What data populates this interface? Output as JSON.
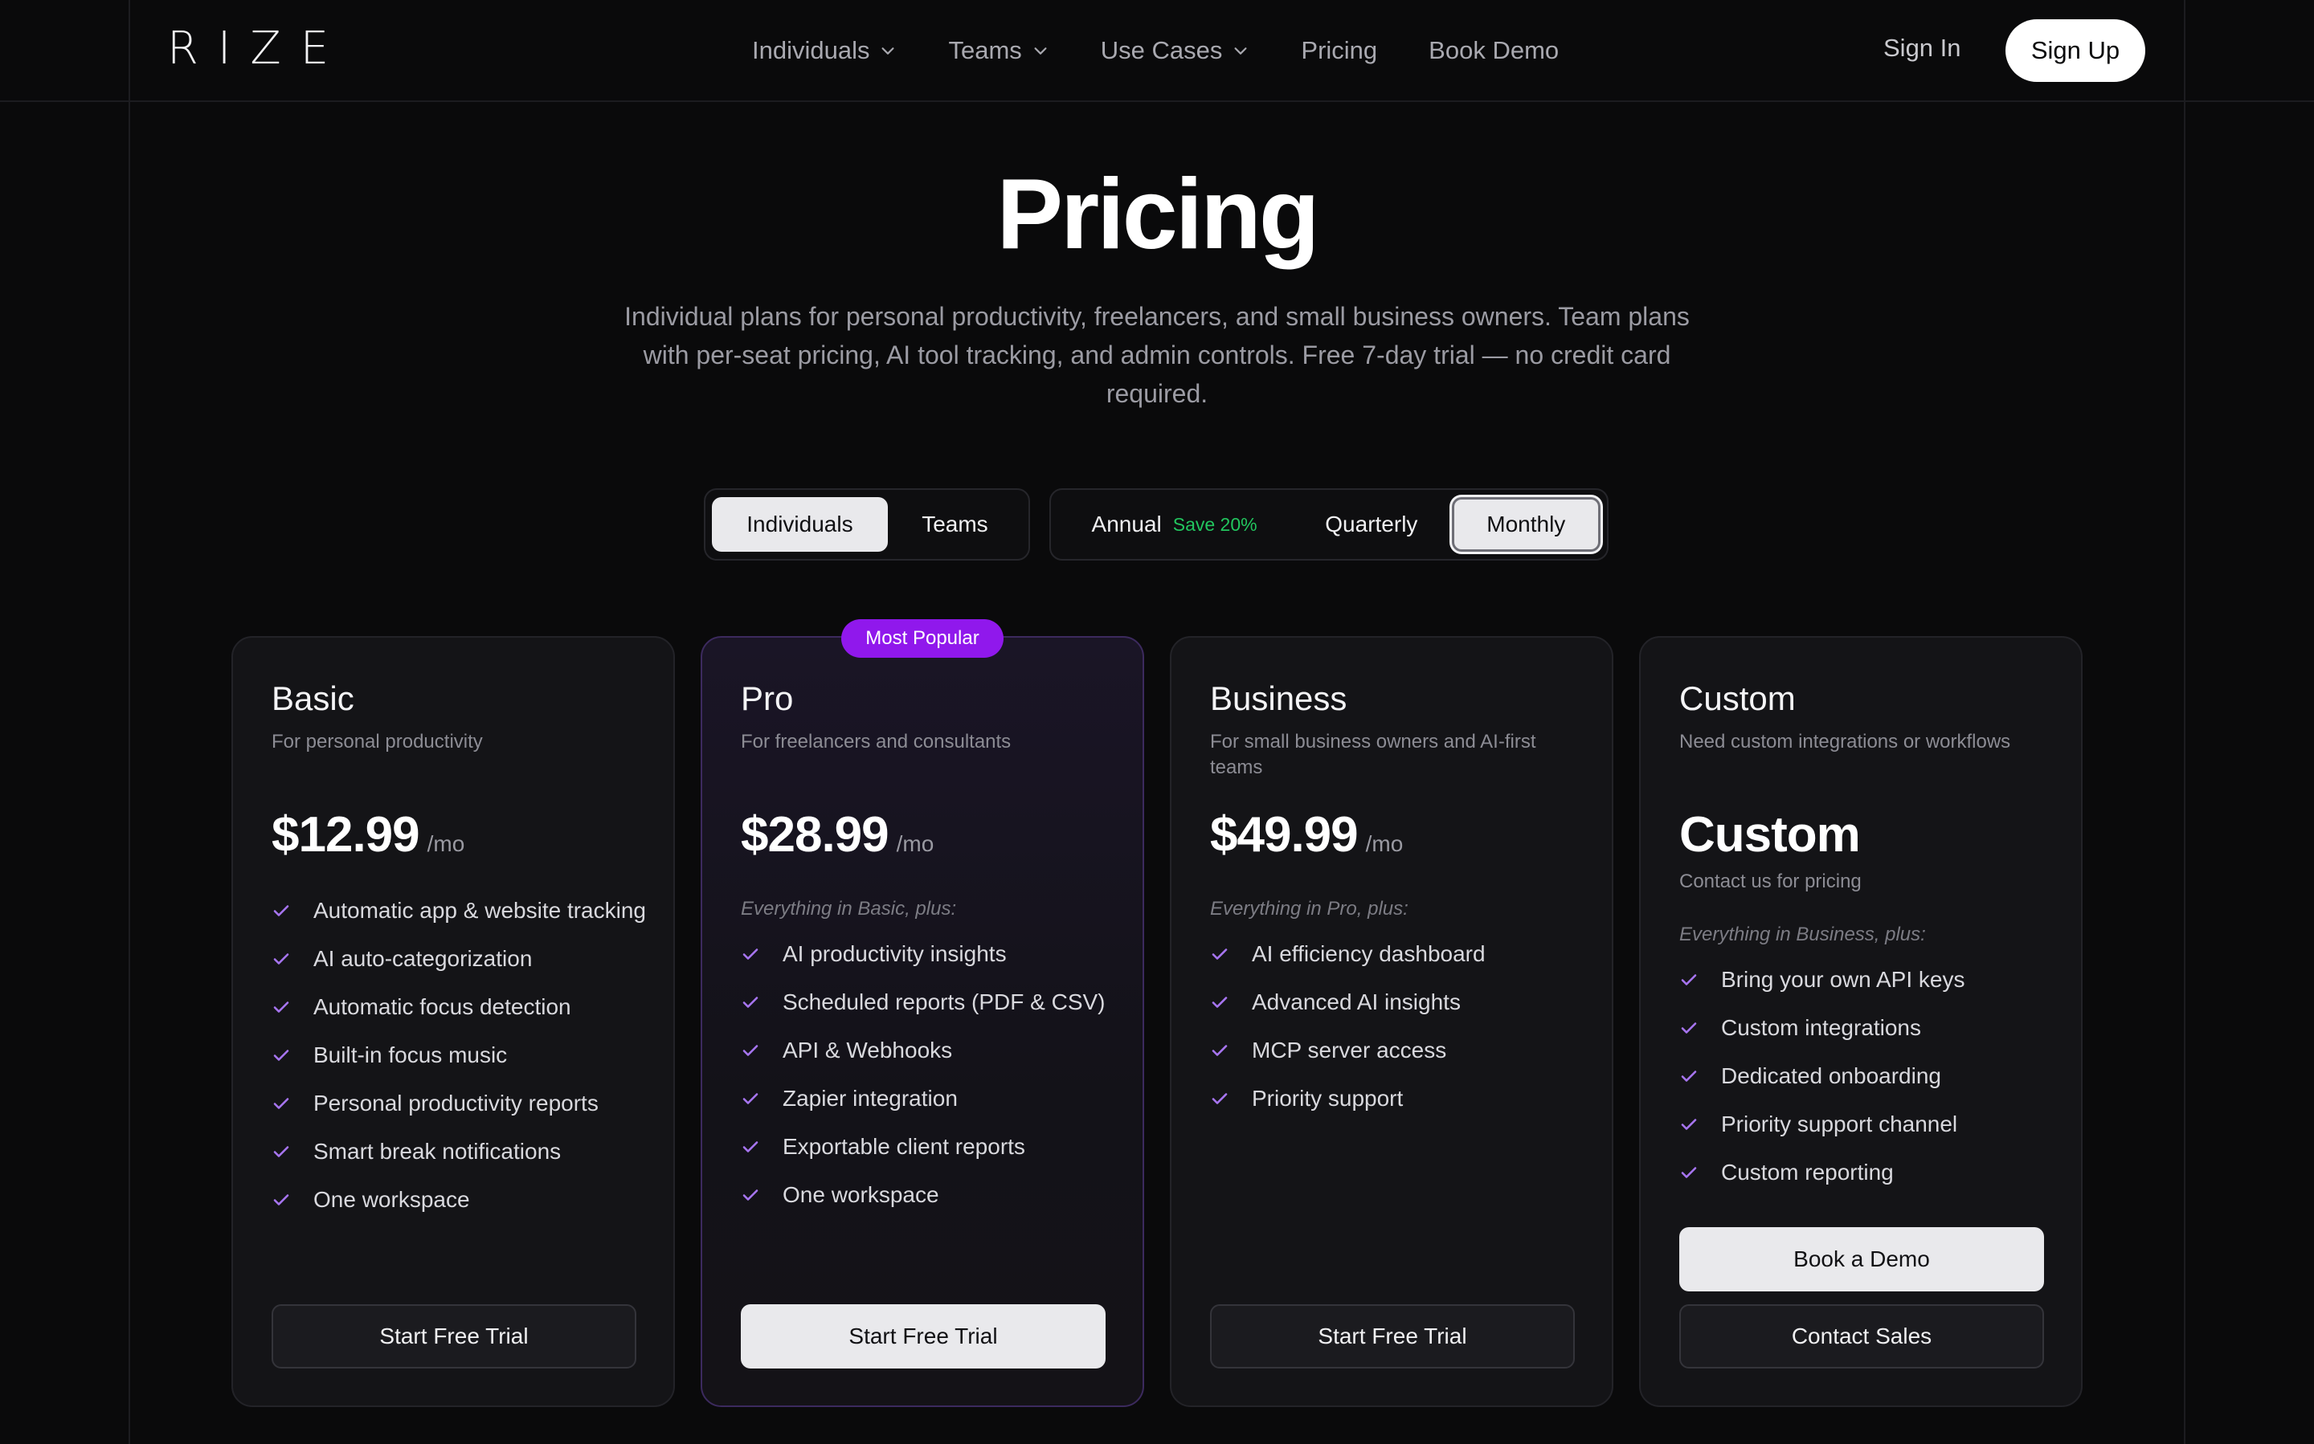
{
  "brand": {
    "logo": "RIZE"
  },
  "nav": {
    "links": [
      {
        "label": "Individuals",
        "has_dropdown": true
      },
      {
        "label": "Teams",
        "has_dropdown": true
      },
      {
        "label": "Use Cases",
        "has_dropdown": true
      },
      {
        "label": "Pricing",
        "has_dropdown": false
      },
      {
        "label": "Book Demo",
        "has_dropdown": false
      }
    ],
    "sign_in": "Sign In",
    "sign_up": "Sign Up"
  },
  "hero": {
    "title": "Pricing",
    "subtitle": "Individual plans for personal productivity, freelancers, and small business owners. Team plans with per-seat pricing, AI tool tracking, and admin controls. Free 7-day trial — no credit card required."
  },
  "toggles": {
    "audience": {
      "options": [
        "Individuals",
        "Teams"
      ],
      "selected": "Individuals"
    },
    "billing": {
      "options": [
        "Annual",
        "Quarterly",
        "Monthly"
      ],
      "annual_badge": "Save 20%",
      "selected": "Monthly"
    }
  },
  "plans": [
    {
      "name": "Basic",
      "description": "For personal productivity",
      "price": "$12.99",
      "period": "/mo",
      "plus_label": "",
      "features": [
        "Automatic app & website tracking",
        "AI auto-categorization",
        "Automatic focus detection",
        "Built-in focus music",
        "Personal productivity reports",
        "Smart break notifications",
        "One workspace"
      ],
      "cta": "Start Free Trial"
    },
    {
      "name": "Pro",
      "badge": "Most Popular",
      "description": "For freelancers and consultants",
      "price": "$28.99",
      "period": "/mo",
      "plus_label": "Everything in Basic, plus:",
      "features": [
        "AI productivity insights",
        "Scheduled reports (PDF & CSV)",
        "API & Webhooks",
        "Zapier integration",
        "Exportable client reports",
        "One workspace"
      ],
      "cta": "Start Free Trial"
    },
    {
      "name": "Business",
      "description": "For small business owners and AI-first teams",
      "price": "$49.99",
      "period": "/mo",
      "plus_label": "Everything in Pro, plus:",
      "features": [
        "AI efficiency dashboard",
        "Advanced AI insights",
        "MCP server access",
        "Priority support"
      ],
      "cta": "Start Free Trial"
    },
    {
      "name": "Custom",
      "description": "Need custom integrations or workflows",
      "price": "Custom",
      "contact_note": "Contact us for pricing",
      "plus_label": "Everything in Business, plus:",
      "features": [
        "Bring your own API keys",
        "Custom integrations",
        "Dedicated onboarding",
        "Priority support channel",
        "Custom reporting"
      ],
      "cta_primary": "Book a Demo",
      "cta_secondary": "Contact Sales"
    }
  ],
  "colors": {
    "background": "#0a0a0b",
    "accent_purple": "#9018ec",
    "check_purple": "#a775f0",
    "save_green": "#22c55e"
  },
  "icons": {
    "chevron": "chevron-down-icon",
    "check": "check-icon"
  }
}
